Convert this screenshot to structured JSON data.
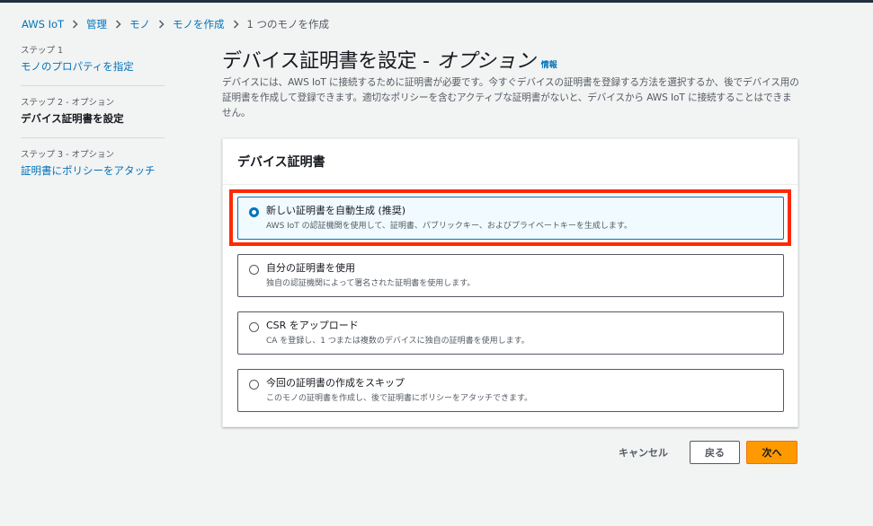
{
  "breadcrumb": {
    "items": [
      "AWS IoT",
      "管理",
      "モノ",
      "モノを作成"
    ],
    "current": "1 つのモノを作成"
  },
  "steps": [
    {
      "meta": "ステップ 1",
      "label": "モノのプロパティを指定"
    },
    {
      "meta": "ステップ 2 - オプション",
      "label": "デバイス証明書を設定"
    },
    {
      "meta": "ステップ 3 - オプション",
      "label": "証明書にポリシーをアタッチ"
    }
  ],
  "page": {
    "title": "デバイス証明書を設定 -",
    "title_optional": "オプション",
    "info": "情報",
    "description": "デバイスには、AWS IoT に接続するために証明書が必要です。今すぐデバイスの証明書を登録する方法を選択するか、後でデバイス用の証明書を作成して登録できます。適切なポリシーを含むアクティブな証明書がないと、デバイスから AWS IoT に接続することはできません。"
  },
  "panel": {
    "title": "デバイス証明書",
    "options": [
      {
        "label": "新しい証明書を自動生成 (推奨)",
        "desc": "AWS IoT の認証機関を使用して、証明書、パブリックキー、およびプライベートキーを生成します。",
        "selected": true
      },
      {
        "label": "自分の証明書を使用",
        "desc": "独自の認証機関によって署名された証明書を使用します。",
        "selected": false
      },
      {
        "label": "CSR をアップロード",
        "desc": "CA を登録し、1 つまたは複数のデバイスに独自の証明書を使用します。",
        "selected": false
      },
      {
        "label": "今回の証明書の作成をスキップ",
        "desc": "このモノの証明書を作成し、後で証明書にポリシーをアタッチできます。",
        "selected": false
      }
    ]
  },
  "actions": {
    "cancel": "キャンセル",
    "back": "戻る",
    "next": "次へ"
  },
  "colors": {
    "link": "#0073bb",
    "primary": "#ff9900",
    "highlight": "#ff2a00"
  }
}
